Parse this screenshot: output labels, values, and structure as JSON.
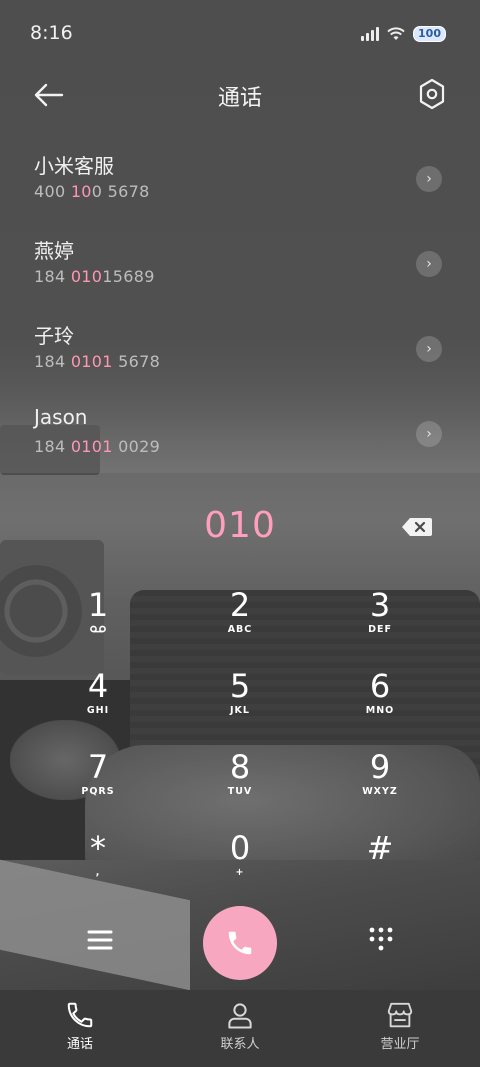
{
  "status": {
    "time": "8:16",
    "battery": "100"
  },
  "header": {
    "title": "通话",
    "back_icon": "back-arrow-icon",
    "settings_icon": "settings-icon"
  },
  "results": [
    {
      "name": "小米客服",
      "num_pre": "400 ",
      "num_hl": "10",
      "num_mid": "0",
      "num_post": " 5678"
    },
    {
      "name": "燕婷",
      "num_pre": "184 ",
      "num_hl": "010",
      "num_mid": "",
      "num_post": "15689"
    },
    {
      "name": "子玲",
      "num_pre": "184 ",
      "num_hl": "0101",
      "num_mid": "",
      "num_post": " 5678"
    },
    {
      "name": "Jason",
      "num_pre": "184 ",
      "num_hl": "0101",
      "num_mid": "",
      "num_post": " 0029"
    }
  ],
  "dialer": {
    "number": "010",
    "keys": [
      {
        "digit": "1",
        "letters": ""
      },
      {
        "digit": "2",
        "letters": "ABC"
      },
      {
        "digit": "3",
        "letters": "DEF"
      },
      {
        "digit": "4",
        "letters": "GHI"
      },
      {
        "digit": "5",
        "letters": "JKL"
      },
      {
        "digit": "6",
        "letters": "MNO"
      },
      {
        "digit": "7",
        "letters": "PQRS"
      },
      {
        "digit": "8",
        "letters": "TUV"
      },
      {
        "digit": "9",
        "letters": "WXYZ"
      },
      {
        "digit": "*",
        "letters": ","
      },
      {
        "digit": "0",
        "letters": "+"
      },
      {
        "digit": "#",
        "letters": ""
      }
    ],
    "accent": "#ff9fbd",
    "call_color": "#f7a8c0"
  },
  "nav": [
    {
      "label": "通话",
      "icon": "phone-icon",
      "active": true
    },
    {
      "label": "联系人",
      "icon": "person-icon",
      "active": false
    },
    {
      "label": "营业厅",
      "icon": "store-icon",
      "active": false
    }
  ]
}
